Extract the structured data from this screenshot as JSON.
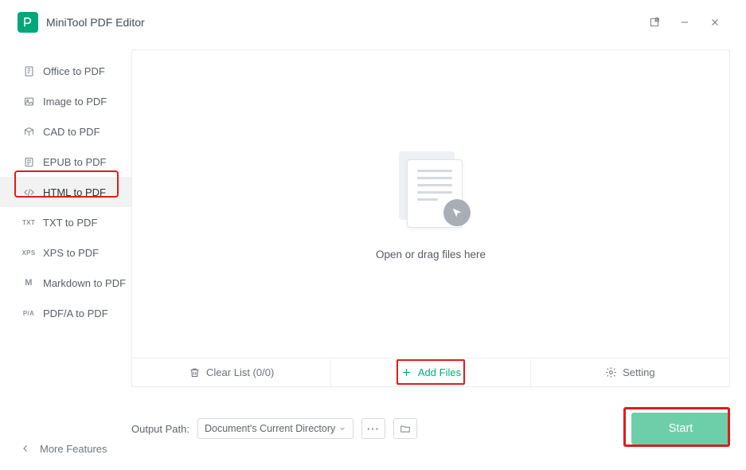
{
  "app_title": "MiniTool PDF Editor",
  "sidebar": {
    "items": [
      {
        "label": "Office to PDF",
        "icon": "office-icon"
      },
      {
        "label": "Image to PDF",
        "icon": "image-icon"
      },
      {
        "label": "CAD to PDF",
        "icon": "cad-icon"
      },
      {
        "label": "EPUB to PDF",
        "icon": "epub-icon"
      },
      {
        "label": "HTML to PDF",
        "icon": "html-icon",
        "selected": true
      },
      {
        "label": "TXT to PDF",
        "icon": "txt-icon",
        "icon_text": "TXT"
      },
      {
        "label": "XPS to PDF",
        "icon": "xps-icon",
        "icon_text": "XPS"
      },
      {
        "label": "Markdown to PDF",
        "icon": "markdown-icon",
        "icon_text": "M"
      },
      {
        "label": "PDF/A to PDF",
        "icon": "pdfa-icon",
        "icon_text": "P/A"
      }
    ],
    "more_label": "More Features"
  },
  "dropzone": {
    "hint": "Open or drag files here"
  },
  "toolbar": {
    "clear_label": "Clear List (0/0)",
    "add_label": "Add Files",
    "setting_label": "Setting"
  },
  "output": {
    "label": "Output Path:",
    "selected": "Document's Current Directory"
  },
  "start_label": "Start"
}
